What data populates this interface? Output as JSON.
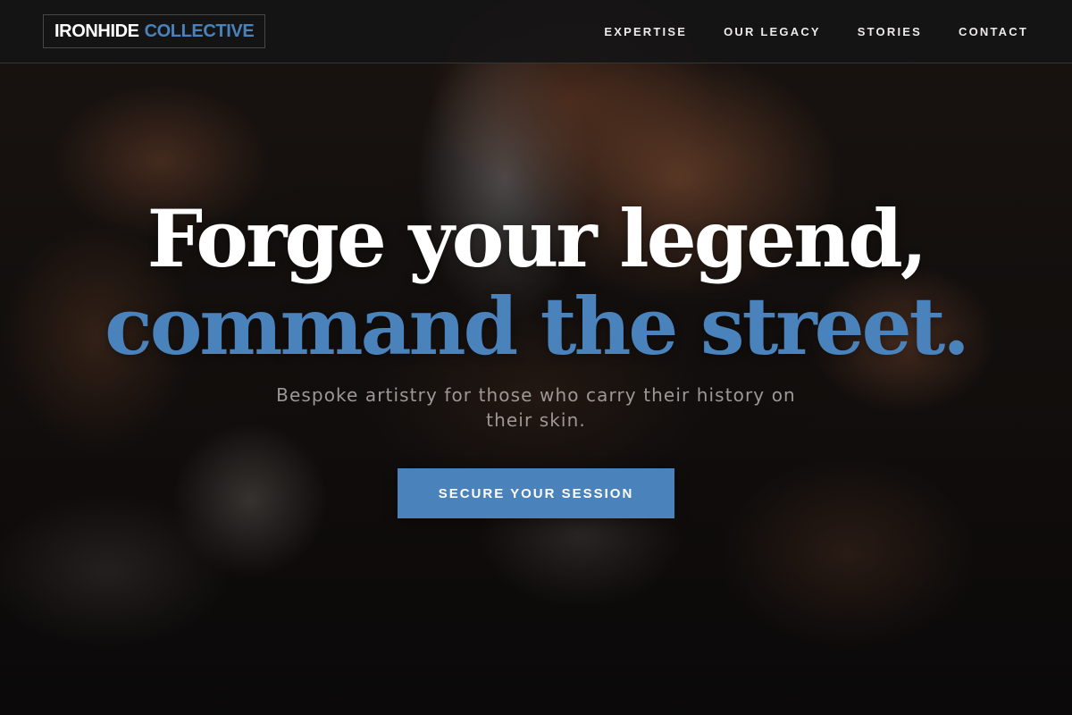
{
  "header": {
    "logo": {
      "primary": "IRONHIDE",
      "accent": "COLLECTIVE"
    },
    "nav": [
      {
        "label": "EXPERTISE"
      },
      {
        "label": "OUR LEGACY"
      },
      {
        "label": "STORIES"
      },
      {
        "label": "CONTACT"
      }
    ]
  },
  "hero": {
    "headline_line1": "Forge your legend,",
    "headline_line2": "command the street.",
    "subhead": "Bespoke artistry for those who carry their history on their skin.",
    "cta_label": "SECURE YOUR SESSION",
    "background_image": "tattoo-artist-at-work-photo"
  },
  "colors": {
    "accent": "#4a82bb",
    "header_bg": "#161415",
    "headline": "#ffffff",
    "subhead": "#9d9795"
  }
}
